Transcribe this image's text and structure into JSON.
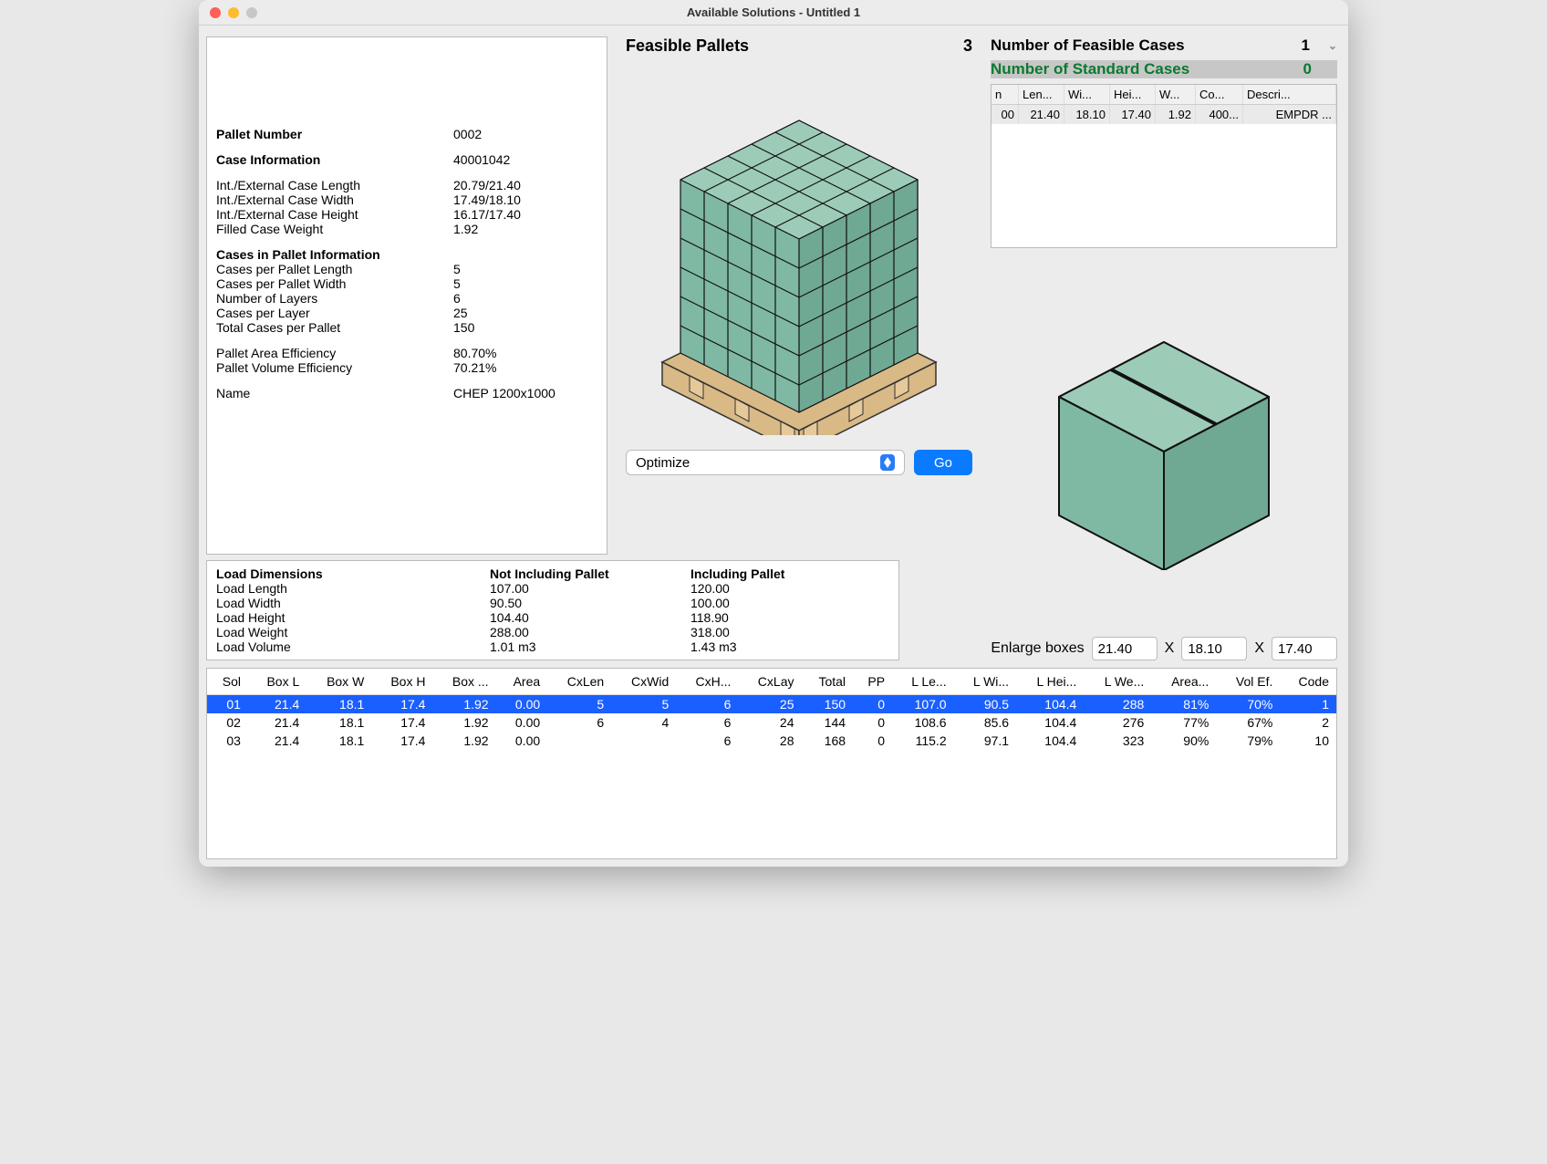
{
  "window_title": "Available Solutions - Untitled 1",
  "info": {
    "pallet_number_label": "Pallet Number",
    "pallet_number": "0002",
    "case_info_label": "Case Information",
    "case_info": "40001042",
    "iec_len_label": "Int./External Case Length",
    "iec_len": "20.79/21.40",
    "iec_wid_label": "Int./External Case Width",
    "iec_wid": "17.49/18.10",
    "iec_hei_label": "Int./External Case Height",
    "iec_hei": "16.17/17.40",
    "fcw_label": "Filled Case Weight",
    "fcw": "1.92",
    "cip_label": "Cases in Pallet Information",
    "cpl_len_label": "Cases per Pallet Length",
    "cpl_len": "5",
    "cpl_wid_label": "Cases per Pallet Width",
    "cpl_wid": "5",
    "layers_label": "Number of Layers",
    "layers": "6",
    "cpl_label": "Cases per Layer",
    "cpl": "25",
    "tcpp_label": "Total Cases per Pallet",
    "tcpp": "150",
    "pae_label": "Pallet Area Efficiency",
    "pae": "80.70%",
    "pve_label": "Pallet Volume Efficiency",
    "pve": "70.21%",
    "name_label": "Name",
    "name": "CHEP 1200x1000"
  },
  "load": {
    "header_dim": "Load Dimensions",
    "header_not": "Not Including Pallet",
    "header_inc": "Including Pallet",
    "rows": [
      {
        "l": "Load Length",
        "n": "107.00",
        "i": "120.00"
      },
      {
        "l": "Load Width",
        "n": "90.50",
        "i": "100.00"
      },
      {
        "l": "Load Height",
        "n": "104.40",
        "i": "118.90"
      },
      {
        "l": "Load Weight",
        "n": "288.00",
        "i": "318.00"
      },
      {
        "l": "Load Volume",
        "n": "1.01 m3",
        "i": "1.43 m3"
      }
    ]
  },
  "center": {
    "feasible_label": "Feasible Pallets",
    "feasible_count": "3",
    "select_value": "Optimize",
    "go_label": "Go"
  },
  "right": {
    "nfc_label": "Number of Feasible Cases",
    "nfc": "1",
    "nsc_label": "Number of Standard Cases",
    "nsc": "0",
    "cols": [
      "n",
      "Len...",
      "Wi...",
      "Hei...",
      "W...",
      "Co...",
      "Descri..."
    ],
    "row": [
      "00",
      "21.40",
      "18.10",
      "17.40",
      "1.92",
      "400...",
      "EMPDR ..."
    ]
  },
  "enlarge": {
    "label": "Enlarge boxes",
    "x": "X",
    "v1": "21.40",
    "v2": "18.10",
    "v3": "17.40"
  },
  "btable": {
    "cols": [
      "Sol",
      "Box L",
      "Box W",
      "Box H",
      "Box ...",
      "Area",
      "CxLen",
      "CxWid",
      "CxH...",
      "CxLay",
      "Total",
      "PP",
      "L Le...",
      "L Wi...",
      "L Hei...",
      "L We...",
      "Area...",
      "Vol Ef.",
      "Code"
    ],
    "rows": [
      [
        "01",
        "21.4",
        "18.1",
        "17.4",
        "1.92",
        "0.00",
        "5",
        "5",
        "6",
        "25",
        "150",
        "0",
        "107.0",
        "90.5",
        "104.4",
        "288",
        "81%",
        "70%",
        "1"
      ],
      [
        "02",
        "21.4",
        "18.1",
        "17.4",
        "1.92",
        "0.00",
        "6",
        "4",
        "6",
        "24",
        "144",
        "0",
        "108.6",
        "85.6",
        "104.4",
        "276",
        "77%",
        "67%",
        "2"
      ],
      [
        "03",
        "21.4",
        "18.1",
        "17.4",
        "1.92",
        "0.00",
        "",
        "",
        "6",
        "28",
        "168",
        "0",
        "115.2",
        "97.1",
        "104.4",
        "323",
        "90%",
        "79%",
        "10"
      ]
    ]
  }
}
